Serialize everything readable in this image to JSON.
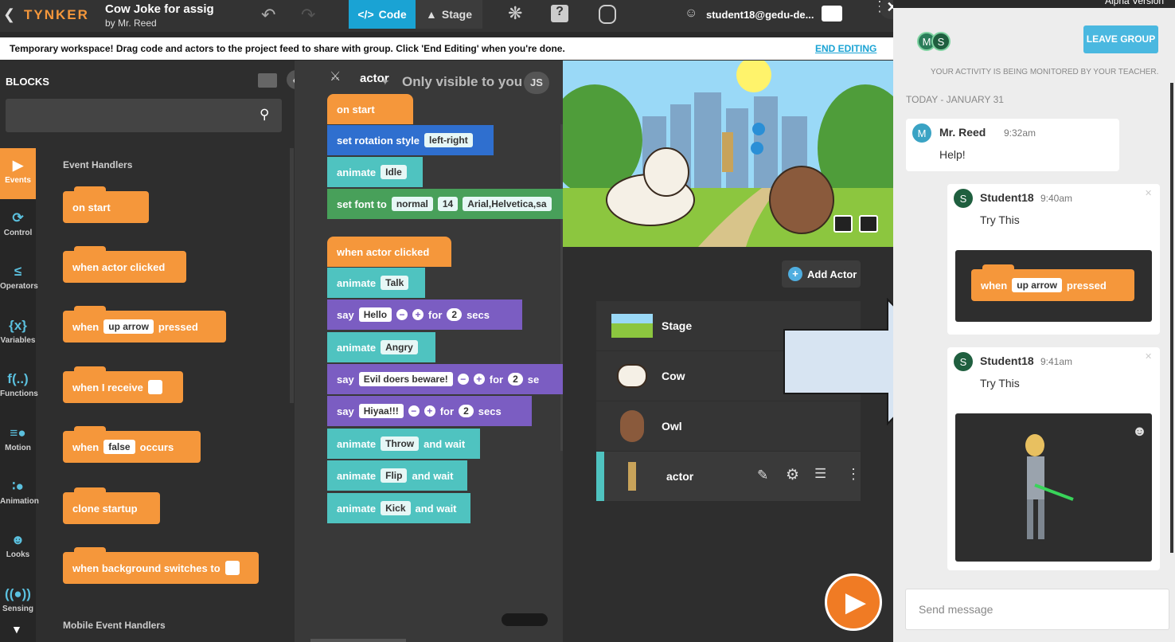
{
  "topbar": {
    "logo": "TYNKER",
    "project_title": "Cow Joke for assig",
    "project_author": "by Mr. Reed",
    "code_tab": "Code",
    "stage_tab": "Stage",
    "user": "student18@gedu-de...",
    "alpha": "Alpha Version"
  },
  "infobar": {
    "message": "Temporary workspace! Drag code and actors to the project feed to share with group. Click 'End Editing' when you're done.",
    "end_editing": "END EDITING"
  },
  "blocks_panel": {
    "title": "BLOCKS",
    "section": "Event Handlers",
    "section2": "Mobile Event Handlers",
    "categories": [
      {
        "label": "Events",
        "icon": "play-icon"
      },
      {
        "label": "Control",
        "icon": "loop-icon"
      },
      {
        "label": "Operators",
        "icon": "less-equal-icon"
      },
      {
        "label": "Variables",
        "icon": "variable-icon"
      },
      {
        "label": "Functions",
        "icon": "function-icon"
      },
      {
        "label": "Motion",
        "icon": "motion-icon"
      },
      {
        "label": "Animation",
        "icon": "animation-icon"
      },
      {
        "label": "Looks",
        "icon": "mask-icon"
      },
      {
        "label": "Sensing",
        "icon": "sensing-icon"
      }
    ],
    "blocks": {
      "on_start": "on start",
      "when_actor_clicked": "when actor clicked",
      "when": "when",
      "up_arrow": "up arrow",
      "pressed": "pressed",
      "when_i_receive": "when I receive",
      "false": "false",
      "occurs": "occurs",
      "clone_startup": "clone startup",
      "when_background": "when background switches to"
    }
  },
  "code": {
    "actor_label": "actor",
    "visibility": "Only visible to you",
    "initials": "JS",
    "on_start": "on start",
    "set_rotation": "set rotation style",
    "left_right": "left-right",
    "animate": "animate",
    "idle": "Idle",
    "set_font": "set font to",
    "normal": "normal",
    "font_size": "14",
    "font_family": "Arial,Helvetica,sa",
    "when_actor_clicked": "when actor clicked",
    "talk": "Talk",
    "say": "say",
    "hello": "Hello",
    "for": "for",
    "two": "2",
    "secs": "secs",
    "se": "se",
    "angry": "Angry",
    "evil": "Evil doers beware!",
    "hiyaa": "Hiyaa!!!",
    "throw": "Throw",
    "and_wait": "and wait",
    "flip": "Flip",
    "kick": "Kick"
  },
  "actors": {
    "add_actor": "Add Actor",
    "list": [
      {
        "name": "Stage"
      },
      {
        "name": "Cow"
      },
      {
        "name": "Owl"
      },
      {
        "name": "actor"
      }
    ]
  },
  "chat": {
    "leave_group": "LEAVE GROUP",
    "members": [
      "M",
      "S"
    ],
    "monitor_notice": "YOUR ACTIVITY IS BEING MONITORED BY YOUR TEACHER.",
    "date": "TODAY - JANUARY 31",
    "messages": [
      {
        "author": "Mr. Reed",
        "initial": "M",
        "time": "9:32am",
        "text": "Help!"
      },
      {
        "author": "Student18",
        "initial": "S",
        "time": "9:40am",
        "text": "Try This",
        "block_when": "when",
        "block_key": "up arrow",
        "block_pressed": "pressed"
      },
      {
        "author": "Student18",
        "initial": "S",
        "time": "9:41am",
        "text": "Try This"
      }
    ],
    "send_placeholder": "Send message"
  },
  "colors": {
    "orange": "#f5973b",
    "teal": "#4fc3c0",
    "blue": "#2f6fcf",
    "purple": "#7b5dc2",
    "green": "#48a05a",
    "accent": "#1aa3d4"
  }
}
